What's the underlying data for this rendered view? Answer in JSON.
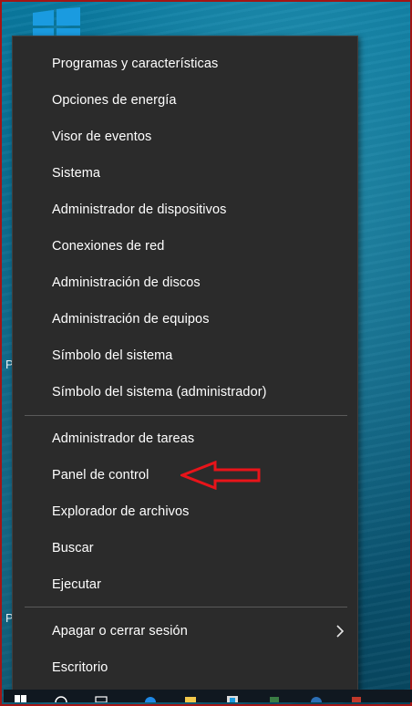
{
  "desktop": {
    "left_letter_1": "P",
    "left_letter_2": "P",
    "windows_logo_color": "#1a9be0"
  },
  "menu": {
    "group1": [
      {
        "label": "Programas y características"
      },
      {
        "label": "Opciones de energía"
      },
      {
        "label": "Visor de eventos"
      },
      {
        "label": "Sistema"
      },
      {
        "label": "Administrador de dispositivos"
      },
      {
        "label": "Conexiones de red"
      },
      {
        "label": "Administración de discos"
      },
      {
        "label": "Administración de equipos"
      },
      {
        "label": "Símbolo del sistema"
      },
      {
        "label": "Símbolo del sistema (administrador)"
      }
    ],
    "group2": [
      {
        "label": "Administrador de tareas"
      },
      {
        "label": "Panel de control"
      },
      {
        "label": "Explorador de archivos"
      },
      {
        "label": "Buscar"
      },
      {
        "label": "Ejecutar"
      }
    ],
    "group3": [
      {
        "label": "Apagar o cerrar sesión",
        "has_submenu": true
      },
      {
        "label": "Escritorio"
      }
    ]
  },
  "annotation": {
    "arrow_color": "#e8141a",
    "points_to": "Panel de control"
  },
  "colors": {
    "menu_bg": "#2b2b2b",
    "menu_text": "#ffffff",
    "divider": "#5a5a5a",
    "border": "#a31515"
  }
}
